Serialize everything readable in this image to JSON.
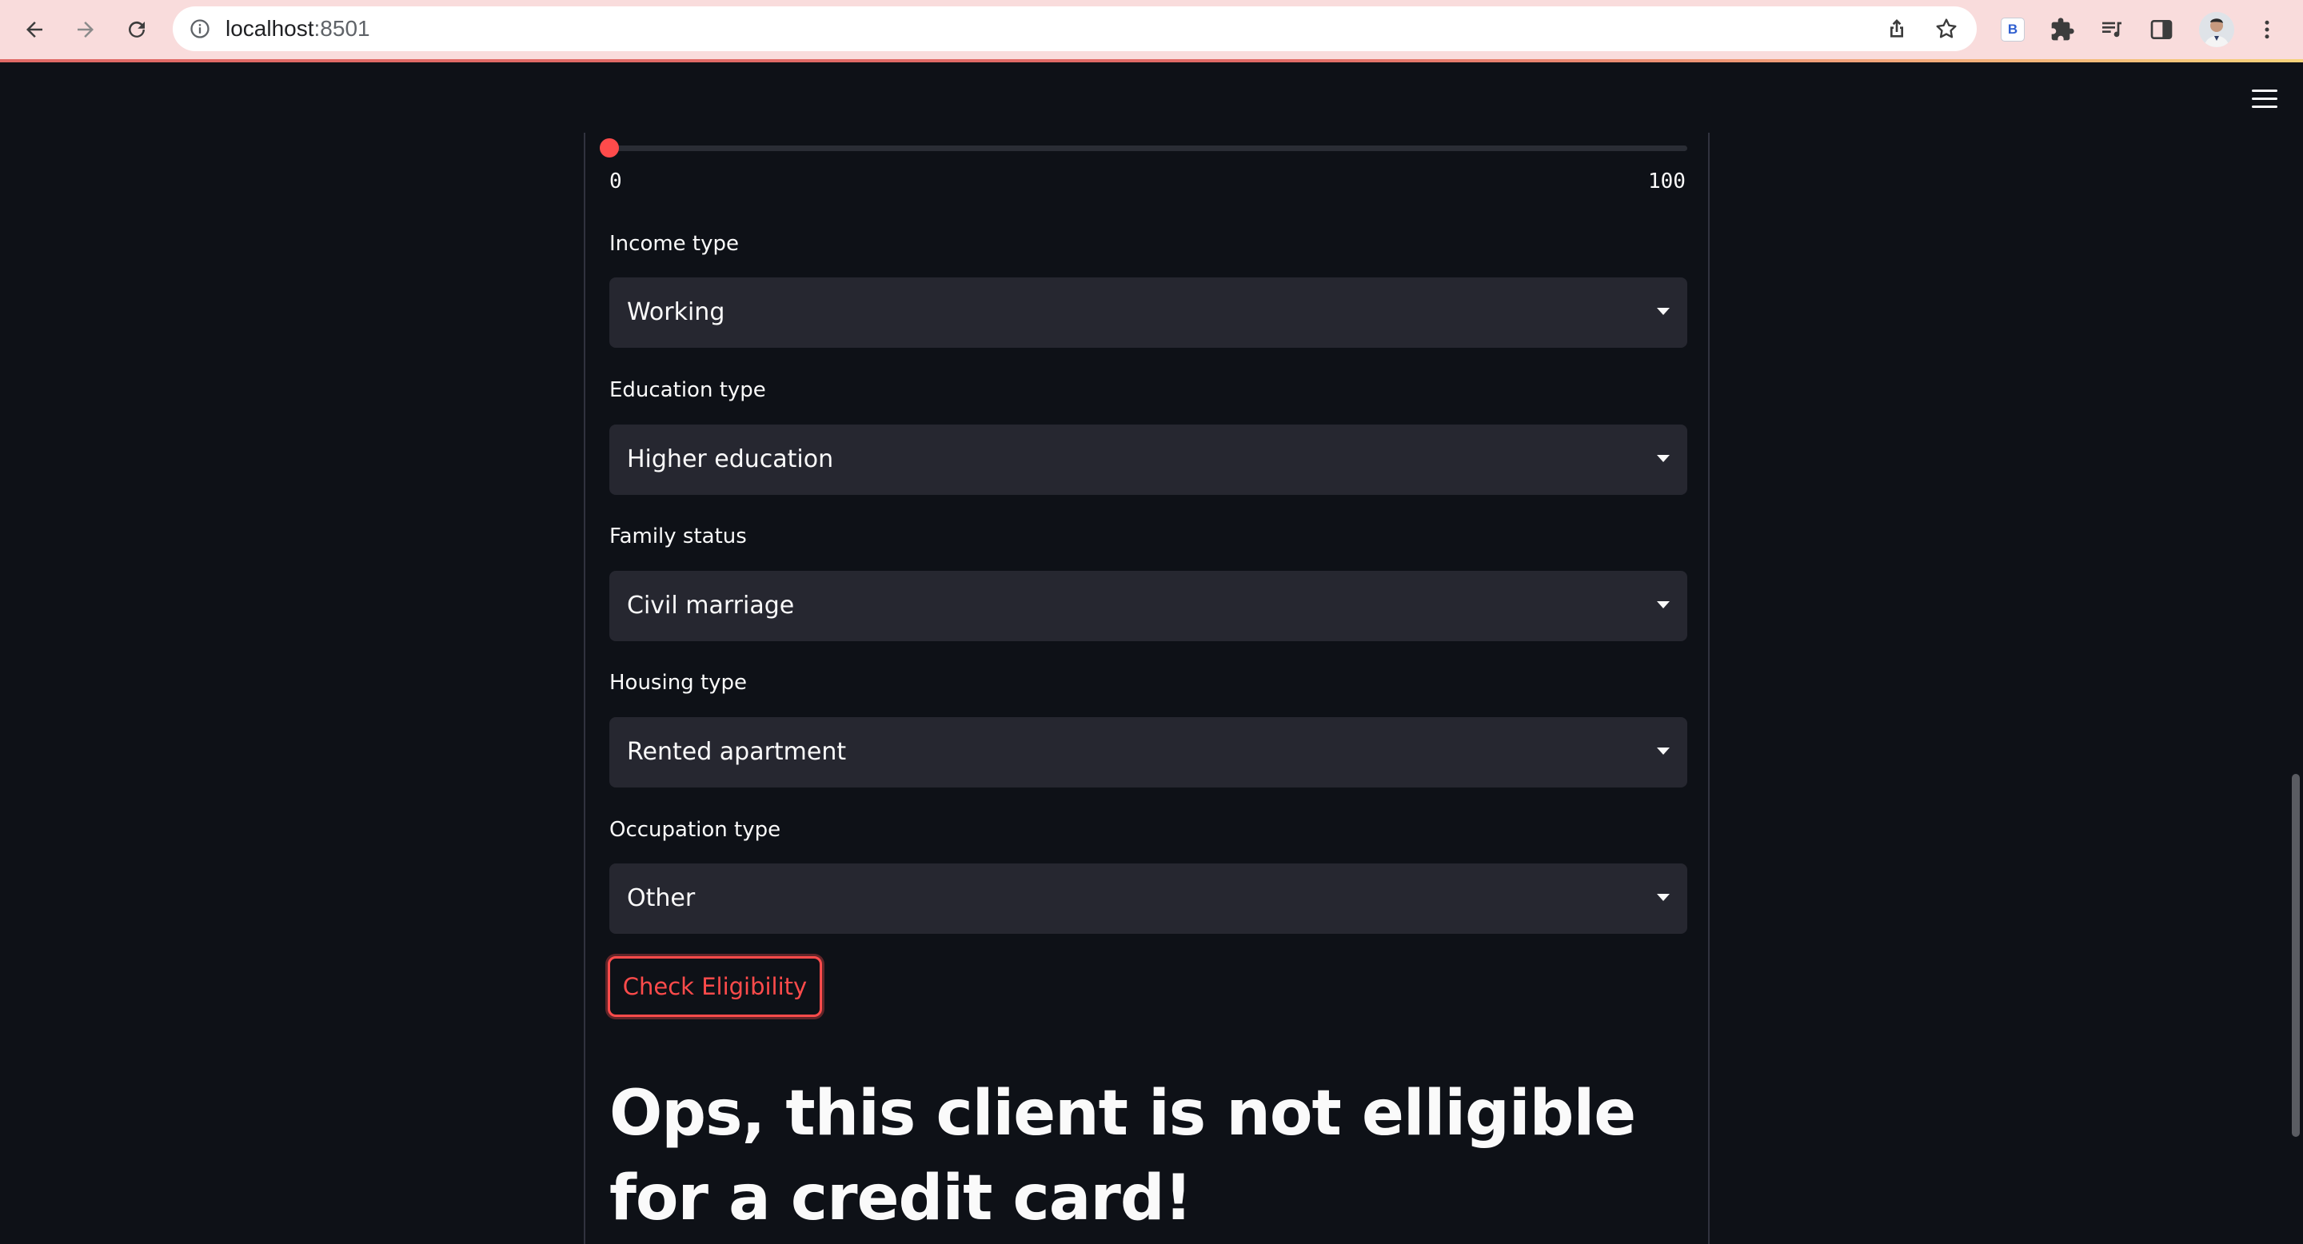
{
  "browser": {
    "url_host": "localhost",
    "url_port": ":8501",
    "extension_badge": "B"
  },
  "slider": {
    "min_label": "0",
    "max_label": "100",
    "value": 0,
    "thumb_color": "#ff4b4b"
  },
  "form": {
    "fields": [
      {
        "label": "Income type",
        "value": "Working"
      },
      {
        "label": "Education type",
        "value": "Higher education"
      },
      {
        "label": "Family status",
        "value": "Civil marriage"
      },
      {
        "label": "Housing type",
        "value": "Rented apartment"
      },
      {
        "label": "Occupation type",
        "value": "Other"
      }
    ],
    "submit_label": "Check Eligibility"
  },
  "result": {
    "heading": "Ops, this client is not elligible for a credit card!"
  },
  "colors": {
    "background": "#0e1117",
    "select_background": "#262730",
    "accent": "#ff4b4b",
    "text": "#fafafa"
  }
}
